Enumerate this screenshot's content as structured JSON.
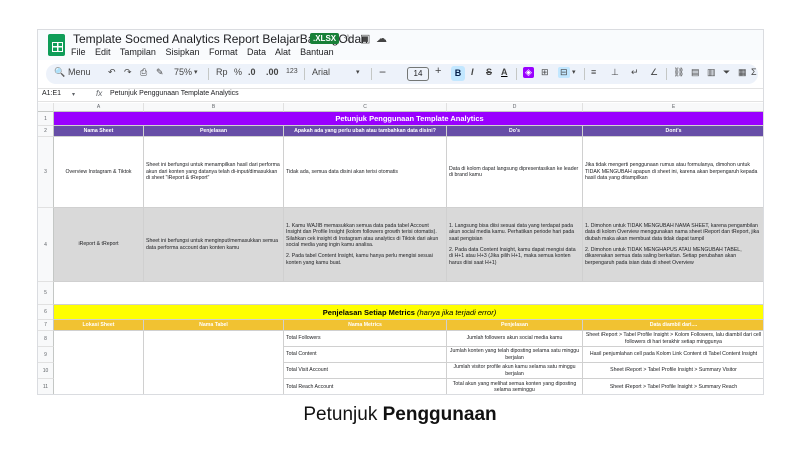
{
  "app": {
    "doc_title": "Template Socmed Analytics Report BelajarBarengOdan",
    "format_badge": ".XLSX",
    "menus": [
      "File",
      "Edit",
      "Tampilan",
      "Sisipkan",
      "Format",
      "Data",
      "Alat",
      "Bantuan"
    ]
  },
  "toolbar": {
    "search_label": "Menu",
    "zoom": "75%",
    "currency": "Rp",
    "percent": "%",
    "dec_decrease": ".0",
    "dec_increase": ".00",
    "number_format": "123",
    "font": "Arial",
    "font_size": "14",
    "bold": "B",
    "italic": "I"
  },
  "formula_bar": {
    "name_box": "A1:E1",
    "fx": "fx",
    "value": "Petunjuk Penggunaan Template Analytics"
  },
  "columns": [
    "A",
    "B",
    "C",
    "D",
    "E"
  ],
  "rows": {
    "r1": "1",
    "r2": "2",
    "r3": "3",
    "r4": "4",
    "r5": "5",
    "r6": "6",
    "r7": "7",
    "r8": "8",
    "r9": "9",
    "r10": "10",
    "r11": "11"
  },
  "sheet": {
    "title1": "Petunjuk Penggunaan Template Analytics",
    "h2": [
      "Nama Sheet",
      "Penjelasan",
      "Apakah ada yang perlu ubah atau tambahkan data disini?",
      "Do's",
      "Dont's"
    ],
    "r3": {
      "a": "Overview Instagram & Tiktok",
      "b": "Sheet ini berfungsi untuk menampilkan hasil dari performa akun dari konten yang datanya telah di-input/dimasukkan di sheet \"iReport & tReport\"",
      "c": "Tidak ada, semua data disini akan terisi otomatis",
      "d": "Data di kolom dapat langsung dipresentasikan ke leader di brand kamu",
      "e": "Jika tidak mengerti penggunaan rumus atau formulanya, dimohon untuk TIDAK MENGUBAH apapun di sheet ini, karena akan berpengaruh kepada hasil data yang ditampilkan"
    },
    "r4": {
      "a": "iReport & tReport",
      "b": "Sheet ini berfungsi untuk menginput/memasukkan semua data performa account dan konten kamu",
      "c1": "1. Kamu WAJIB memasukkan semua data pada tabel Account Insight dan Profile Insight (kolom followers growth terisi otomatis). Silahkan cek insight di Instagram atau analytics di Tiktok dari akun social media yang ingin kamu analisa.",
      "c2": "2. Pada tabel Content Insight, kamu hanya perlu mengisi sesuai konten yang kamu buat.",
      "d1": "1. Langsung bisa diisi sesuai data yang terdapat pada akun social media kamu. Perhatikan periode hari pada saat pengisian",
      "d2": "2. Pada data Content Insight, kamu dapat mengisi data di H+1 atau H+3 (Jika pilih H+1, maka semua konten harus diisi saat H+1)",
      "e1": "1. Dimohon untuk TIDAK MENGUBAH NAMA SHEET, karena pengambilan data di kolom Overview menggunakan nama sheet iReport dan tReport, jika diubah maka akan membuat data tidak dapat tampil",
      "e2": "2. Dimohon untuk TIDAK MENGHAPUS ATAU MENGUBAH TABEL, dikarenakan semua data saling berkaitan. Setiap perubahan akan berpengaruh pada isian data di sheet Overview"
    },
    "title6_main": "Penjelasan Setiap Metrics",
    "title6_note": "(hanya jika terjadi error)",
    "h7": [
      "Lokasi Sheet",
      "Nama Tabel",
      "Nama Metrics",
      "Penjelasan",
      "Data diambil dari...."
    ],
    "metrics": [
      {
        "name": "Total Followers",
        "desc": "Jumlah followers akun social media kamu",
        "source": "Sheet iReport > Tabel Profile Insight > Kolom Followers, lalu diambil dari cell followers di hari terakhir setiap minggunya"
      },
      {
        "name": "Total Content",
        "desc": "Jumlah konten yang telah diposting selama satu minggu berjalan",
        "source": "Hasil penjumlahan cell pada Kolom Link Content di Tabel Content Insight"
      },
      {
        "name": "Total Visit Account",
        "desc": "Jumlah visitor profile akun kamu selama satu minggu berjalan",
        "source": "Sheet iReport > Tabel Profile Insight > Summary Visitor"
      },
      {
        "name": "Total Reach Account",
        "desc": "Total akun yang melihat semua konten yang diposting selama seminggu",
        "source": "Sheet iReport > Tabel Profile Insight > Summary Reach"
      }
    ]
  },
  "caption": {
    "normal": "Petunjuk ",
    "bold": "Penggunaan"
  }
}
